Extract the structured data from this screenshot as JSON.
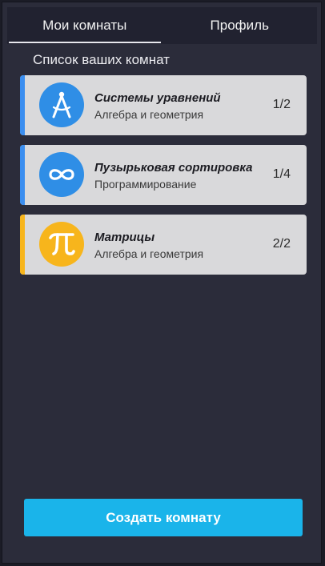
{
  "tabs": [
    {
      "label": "Мои комнаты",
      "active": true
    },
    {
      "label": "Профиль",
      "active": false
    }
  ],
  "section_title": "Список ваших комнат",
  "rooms": [
    {
      "name": "Системы уравнений",
      "subject": "Алгебра и геометрия",
      "count": "1/2",
      "icon": "compass-icon",
      "icon_color": "#2f8ee6",
      "stripe_color": "#3a8ef0"
    },
    {
      "name": "Пузырьковая сортировка",
      "subject": "Программирование",
      "count": "1/4",
      "icon": "infinity-icon",
      "icon_color": "#2f8ee6",
      "stripe_color": "#3a8ef0"
    },
    {
      "name": "Матрицы",
      "subject": "Алгебра и геометрия",
      "count": "2/2",
      "icon": "pi-icon",
      "icon_color": "#f7b51c",
      "stripe_color": "#f7b51c"
    }
  ],
  "create_button": {
    "label": "Создать комнату",
    "color": "#1ab4ea"
  }
}
